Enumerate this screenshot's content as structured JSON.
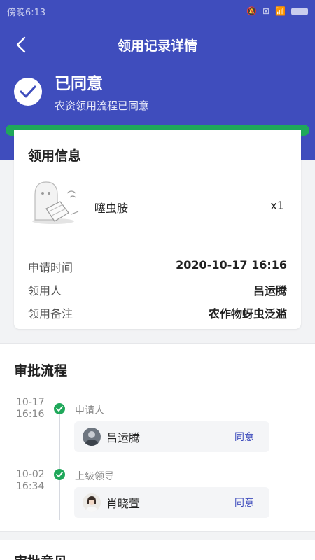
{
  "statusbar": {
    "time": "傍晚6:13"
  },
  "nav": {
    "title": "领用记录详情"
  },
  "status": {
    "title": "已同意",
    "subtitle": "农资领用流程已同意"
  },
  "usage_info": {
    "title": "领用信息",
    "item": {
      "name": "噻虫胺",
      "qty": "x1"
    },
    "rows": [
      {
        "label": "申请时间",
        "value": "2020-10-17 16:16"
      },
      {
        "label": "领用人",
        "value": "吕运腾"
      },
      {
        "label": "领用备注",
        "value": "农作物蚜虫泛滥"
      }
    ]
  },
  "approval": {
    "title": "审批流程",
    "steps": [
      {
        "date": "10-17",
        "time": "16:16",
        "role": "申请人",
        "name": "吕运腾",
        "result": "同意"
      },
      {
        "date": "10-02",
        "time": "16:34",
        "role": "上级领导",
        "name": "肖晓萱",
        "result": "同意"
      }
    ]
  },
  "opinion": {
    "title": "审批意见"
  },
  "colors": {
    "primary": "#3f4dbd",
    "success": "#1fa85a",
    "background": "#f2f3f5"
  }
}
